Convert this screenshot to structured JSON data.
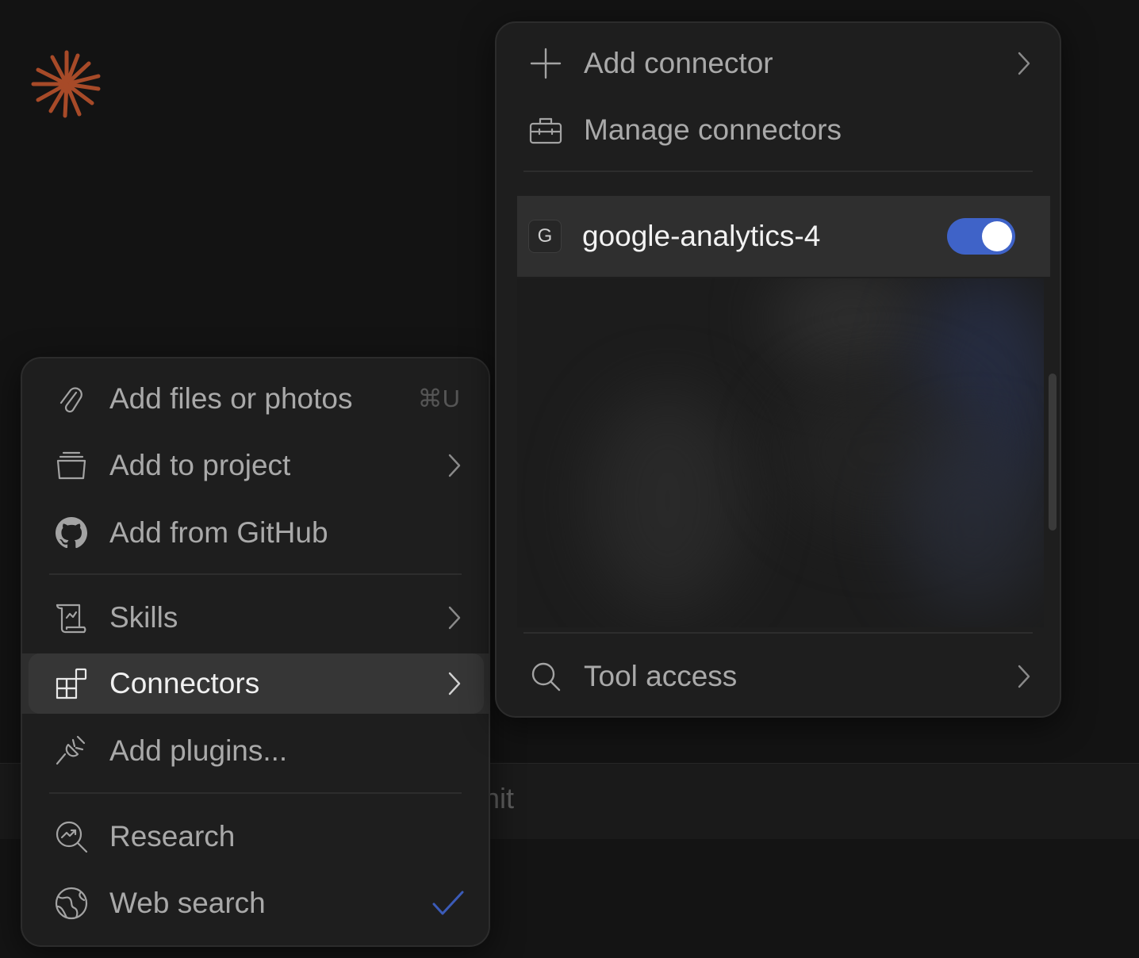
{
  "background": {
    "input_fragment": "hit"
  },
  "left_menu": {
    "items": [
      {
        "label": "Add files or photos",
        "icon": "paperclip-icon",
        "shortcut": "⌘U"
      },
      {
        "label": "Add to project",
        "icon": "project-box-icon"
      },
      {
        "label": "Add from GitHub",
        "icon": "github-icon"
      },
      {
        "label": "Skills",
        "icon": "scroll-icon"
      },
      {
        "label": "Connectors",
        "icon": "connectors-icon"
      },
      {
        "label": "Add plugins...",
        "icon": "plug-icon"
      },
      {
        "label": "Research",
        "icon": "research-icon"
      },
      {
        "label": "Web search",
        "icon": "globe-icon",
        "checked": true
      }
    ],
    "highlighted": "Connectors"
  },
  "right_menu": {
    "add_connector": "Add connector",
    "manage_connectors": "Manage connectors",
    "connector": {
      "badge": "G",
      "name": "google-analytics-4",
      "enabled": true
    },
    "tool_access": "Tool access"
  },
  "colors": {
    "accent": "#3f63c8",
    "logo": "#b5522d",
    "check": "#3b5bb8"
  }
}
